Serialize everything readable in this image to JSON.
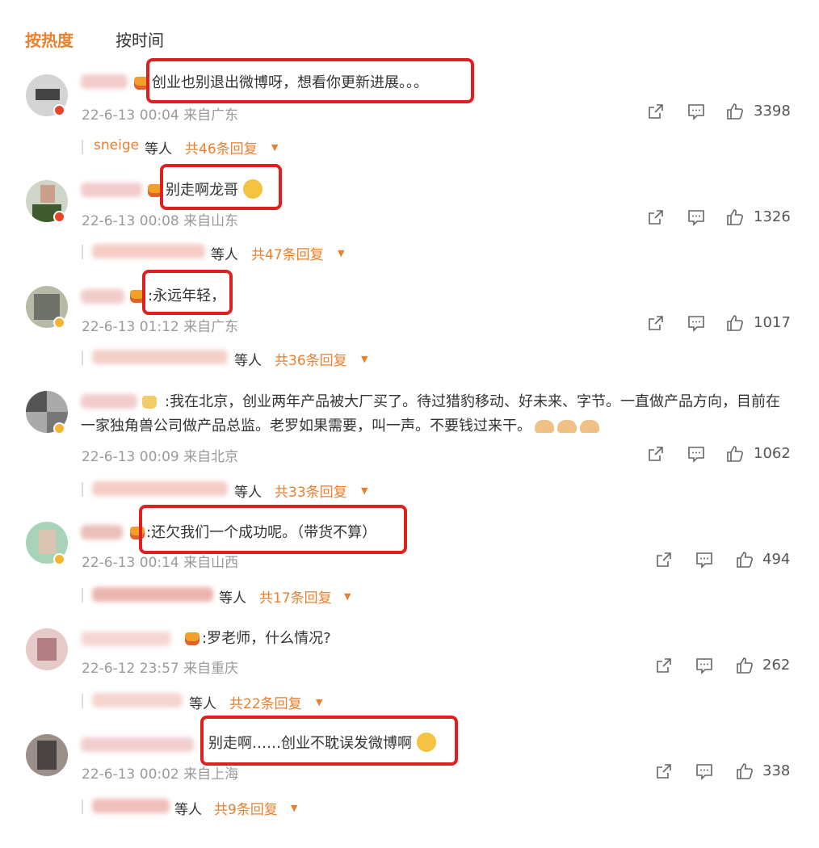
{
  "tabs": {
    "hot": "按热度",
    "time": "按时间"
  },
  "actions": {
    "etc": "等人"
  },
  "comments": [
    {
      "text": "创业也别退出微博呀，想看你更新进展。。。",
      "date": "22-6-13 00:04",
      "location": "来自广东",
      "likes": "3398",
      "reply_names": "sneige",
      "reply_count": "共46条回复"
    },
    {
      "text": "别走啊龙哥",
      "date": "22-6-13 00:08",
      "location": "来自山东",
      "likes": "1326",
      "reply_names": "",
      "reply_count": "共47条回复"
    },
    {
      "text": ":永远年轻，",
      "date": "22-6-13 01:12",
      "location": "来自广东",
      "likes": "1017",
      "reply_names": "",
      "reply_count": "共36条回复"
    },
    {
      "text": ":我在北京，创业两年产品被大厂买了。待过猎豹移动、好未来、字节。一直做产品方向，目前在一家独角兽公司做产品总监。老罗如果需要，叫一声。不要钱过来干。",
      "date": "22-6-13 00:09",
      "location": "来自北京",
      "likes": "1062",
      "reply_names": "",
      "reply_count": "共33条回复"
    },
    {
      "text": ":还欠我们一个成功呢。（带货不算）",
      "date": "22-6-13 00:14",
      "location": "来自山西",
      "likes": "494",
      "reply_names": "",
      "reply_count": "共17条回复"
    },
    {
      "text": ":罗老师，什么情况?",
      "date": "22-6-12 23:57",
      "location": "来自重庆",
      "likes": "262",
      "reply_names": "",
      "reply_count": "共22条回复"
    },
    {
      "text": "别走啊……创业不耽误发微博啊",
      "date": "22-6-13 00:02",
      "location": "来自上海",
      "likes": "338",
      "reply_names": "",
      "reply_count": "共9条回复"
    }
  ],
  "icons": {
    "share": "share-icon",
    "comment": "comment-icon",
    "like": "like-icon",
    "crown": "crown-icon",
    "verified": "verified-badge-icon"
  },
  "colors": {
    "accent": "#e8802f",
    "highlight": "#e02020",
    "meta": "#9a9a9a"
  }
}
